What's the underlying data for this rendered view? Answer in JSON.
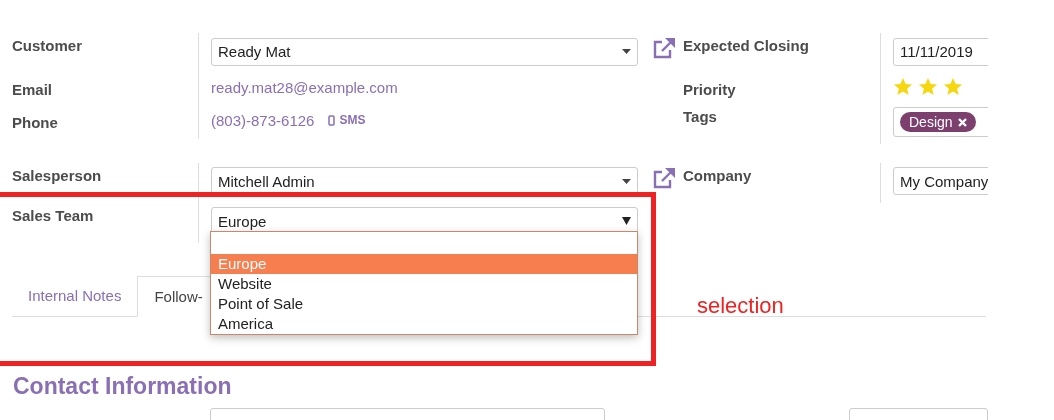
{
  "left_group_1": [
    {
      "label": "Customer",
      "kind": "select",
      "value": "Ready Mat"
    },
    {
      "label": "Email",
      "kind": "link",
      "value": "ready.mat28@example.com"
    },
    {
      "label": "Phone",
      "kind": "phone",
      "value": "(803)-873-6126",
      "action": "SMS"
    }
  ],
  "right_group_1": [
    {
      "label": "Expected Closing",
      "kind": "input",
      "value": "11/11/2019",
      "link_icon": true
    },
    {
      "label": "Priority",
      "kind": "stars",
      "stars": 3
    },
    {
      "label": "Tags",
      "kind": "tags",
      "tags": [
        {
          "label": "Design",
          "color": "#7c3f6e"
        }
      ]
    }
  ],
  "left_group_2": [
    {
      "label": "Salesperson",
      "kind": "select",
      "value": "Mitchell Admin"
    },
    {
      "label": "Sales Team",
      "kind": "native_select",
      "value": "Europe"
    }
  ],
  "right_group_2": [
    {
      "label": "Company",
      "kind": "input",
      "value": "My Company",
      "link_icon": true
    }
  ],
  "dropdown": {
    "options": [
      {
        "label": "Europe",
        "selected": true
      },
      {
        "label": "Website",
        "selected": false
      },
      {
        "label": "Point of Sale",
        "selected": false
      },
      {
        "label": "America",
        "selected": false
      }
    ]
  },
  "tabs": [
    {
      "label": "Internal Notes",
      "selected": false
    },
    {
      "label": "Follow-",
      "selected": true
    }
  ],
  "annotation": {
    "label": "selection"
  },
  "section_title": "Contact Information"
}
